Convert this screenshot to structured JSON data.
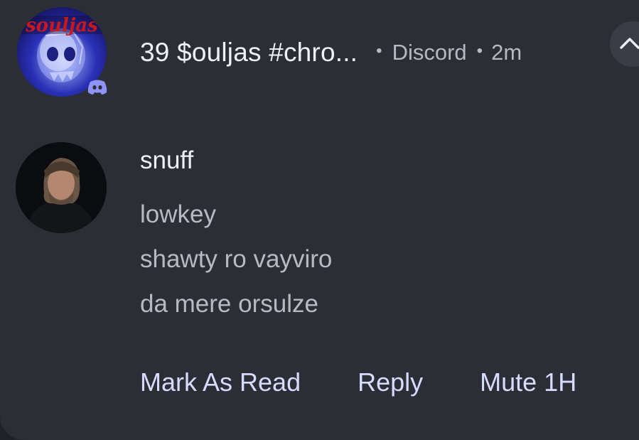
{
  "notification": {
    "app_name": "Discord",
    "app_icon": "discord-icon",
    "group_title": "39 $ouljas #chro...",
    "separator": "•",
    "time": "2m",
    "group_avatar_text": "souljas",
    "expand_icon": "chevron-up-icon"
  },
  "message": {
    "sender": "snuff",
    "lines": [
      "lowkey",
      "shawty ro vayviro",
      "da mere orsulze"
    ]
  },
  "actions": {
    "mark_read": "Mark As Read",
    "reply": "Reply",
    "mute": "Mute 1H"
  },
  "colors": {
    "card_background": "#2c2e36",
    "action_text": "#d7dbff",
    "discord_badge": "#5865f2"
  }
}
